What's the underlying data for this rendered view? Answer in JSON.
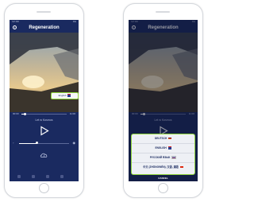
{
  "player": {
    "status_time": "12:00",
    "status_signal": "4G",
    "title": "Regeneration",
    "language_chip": "English",
    "time_start": "00:00",
    "time_end": "11:00",
    "progress": 0.08,
    "volume": 0.35,
    "track_title": "Let w Kosmos"
  },
  "language_menu": {
    "items": [
      {
        "label": "DEUTSCH",
        "flag": "de"
      },
      {
        "label": "ENGLISH",
        "flag": "gb"
      },
      {
        "label": "РУССКИЙ ЯЗЫК",
        "flag": "ru"
      },
      {
        "label": "中文 (ZHŌNGWÉN), 汉语, 漢語",
        "flag": "cn"
      }
    ],
    "cancel_label": "CANCEL"
  },
  "colors": {
    "background_navy": "#1a2a60",
    "highlight_green": "#8ed43a"
  }
}
